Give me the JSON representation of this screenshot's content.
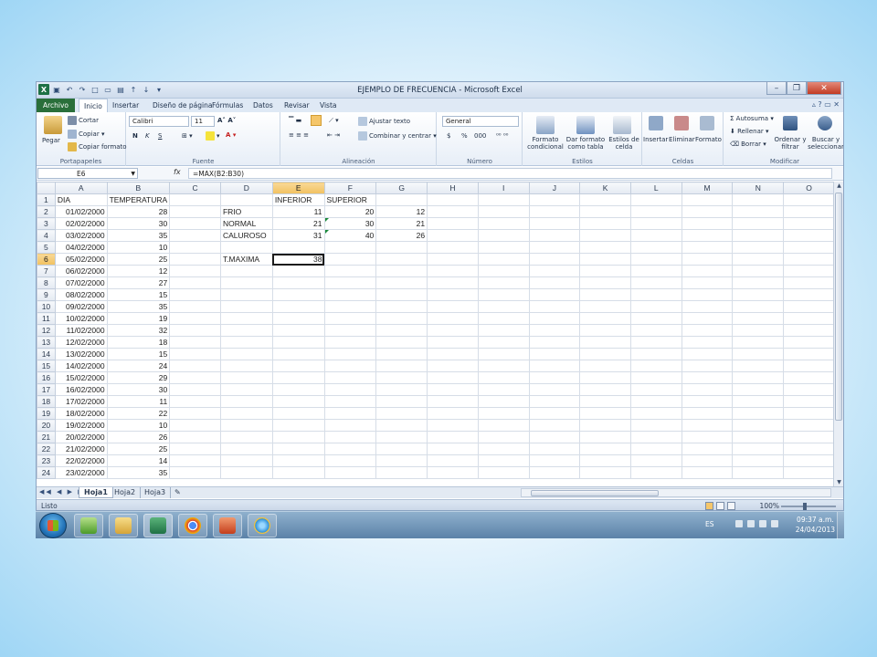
{
  "window": {
    "title": "EJEMPLO DE FRECUENCIA - Microsoft Excel"
  },
  "tabs": {
    "file": "Archivo",
    "items": [
      "Inicio",
      "Insertar",
      "Diseño de página",
      "Fórmulas",
      "Datos",
      "Revisar",
      "Vista"
    ]
  },
  "ribbon": {
    "clipboard": {
      "label": "Portapapeles",
      "paste": "Pegar",
      "cut": "Cortar",
      "copy": "Copiar",
      "format_painter": "Copiar formato"
    },
    "font": {
      "label": "Fuente",
      "font_name": "Calibri",
      "font_size": "11",
      "bold": "N",
      "italic": "K",
      "underline": "S"
    },
    "alignment": {
      "label": "Alineación",
      "wrap": "Ajustar texto",
      "merge": "Combinar y centrar"
    },
    "number": {
      "label": "Número",
      "format": "General",
      "currency": "$",
      "percent": "%",
      "thousands": "000"
    },
    "styles": {
      "label": "Estilos",
      "conditional": "Formato condicional",
      "table": "Dar formato como tabla",
      "cell": "Estilos de celda"
    },
    "cells": {
      "label": "Celdas",
      "insert": "Insertar",
      "delete": "Eliminar",
      "format": "Formato"
    },
    "editing": {
      "label": "Modificar",
      "autosum": "Autosuma",
      "fill": "Rellenar",
      "clear": "Borrar",
      "sort": "Ordenar y filtrar",
      "find": "Buscar y seleccionar"
    }
  },
  "formula_bar": {
    "name_box": "E6",
    "fx": "fx",
    "formula": "=MAX(B2:B30)"
  },
  "sheet": {
    "columns": [
      "A",
      "B",
      "C",
      "D",
      "E",
      "F",
      "G",
      "H",
      "I",
      "J",
      "K",
      "L",
      "M",
      "N",
      "O"
    ],
    "active_cell": "E6",
    "rows": [
      {
        "n": "1",
        "A": "DIA",
        "B": "TEMPERATURA",
        "D": "",
        "E": "INFERIOR",
        "F": "SUPERIOR",
        "G": ""
      },
      {
        "n": "2",
        "A": "01/02/2000",
        "B": "28",
        "D": "FRIO",
        "E": "11",
        "F": "20",
        "G": "12"
      },
      {
        "n": "3",
        "A": "02/02/2000",
        "B": "30",
        "D": "NORMAL",
        "E": "21",
        "F": "30",
        "G": "21"
      },
      {
        "n": "4",
        "A": "03/02/2000",
        "B": "35",
        "D": "CALUROSO",
        "E": "31",
        "F": "40",
        "G": "26"
      },
      {
        "n": "5",
        "A": "04/02/2000",
        "B": "10",
        "D": "",
        "E": "",
        "F": "",
        "G": ""
      },
      {
        "n": "6",
        "A": "05/02/2000",
        "B": "25",
        "D": "T.MAXIMA",
        "E": "38",
        "F": "",
        "G": ""
      },
      {
        "n": "7",
        "A": "06/02/2000",
        "B": "12"
      },
      {
        "n": "8",
        "A": "07/02/2000",
        "B": "27"
      },
      {
        "n": "9",
        "A": "08/02/2000",
        "B": "15"
      },
      {
        "n": "10",
        "A": "09/02/2000",
        "B": "35"
      },
      {
        "n": "11",
        "A": "10/02/2000",
        "B": "19"
      },
      {
        "n": "12",
        "A": "11/02/2000",
        "B": "32"
      },
      {
        "n": "13",
        "A": "12/02/2000",
        "B": "18"
      },
      {
        "n": "14",
        "A": "13/02/2000",
        "B": "15"
      },
      {
        "n": "15",
        "A": "14/02/2000",
        "B": "24"
      },
      {
        "n": "16",
        "A": "15/02/2000",
        "B": "29"
      },
      {
        "n": "17",
        "A": "16/02/2000",
        "B": "30"
      },
      {
        "n": "18",
        "A": "17/02/2000",
        "B": "11"
      },
      {
        "n": "19",
        "A": "18/02/2000",
        "B": "22"
      },
      {
        "n": "20",
        "A": "19/02/2000",
        "B": "10"
      },
      {
        "n": "21",
        "A": "20/02/2000",
        "B": "26"
      },
      {
        "n": "22",
        "A": "21/02/2000",
        "B": "25"
      },
      {
        "n": "23",
        "A": "22/02/2000",
        "B": "14"
      },
      {
        "n": "24",
        "A": "23/02/2000",
        "B": "35"
      }
    ],
    "tabs": [
      "Hoja1",
      "Hoja2",
      "Hoja3"
    ]
  },
  "status": {
    "ready": "Listo",
    "zoom": "100%"
  },
  "taskbar": {
    "lang": "ES",
    "time": "09:37 a.m.",
    "date": "24/04/2013"
  },
  "colors": {
    "file_tab": "#2a6f3a",
    "selected_header": "#f1c15f"
  }
}
